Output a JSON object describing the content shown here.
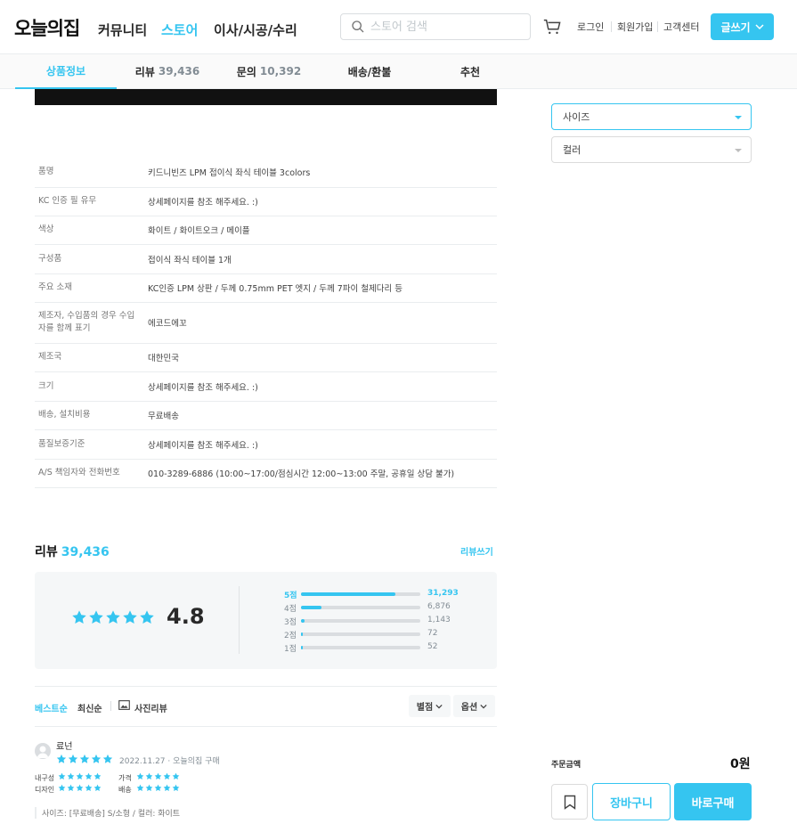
{
  "header": {
    "logo": "오늘의집",
    "nav": [
      "커뮤니티",
      "스토어",
      "이사/시공/수리"
    ],
    "search_placeholder": "스토어 검색",
    "util": [
      "로그인",
      "회원가입",
      "고객센터"
    ],
    "write_label": "글쓰기"
  },
  "tabs": [
    {
      "label": "상품정보",
      "count": ""
    },
    {
      "label": "리뷰",
      "count": "39,436"
    },
    {
      "label": "문의",
      "count": "10,392"
    },
    {
      "label": "배송/환불",
      "count": ""
    },
    {
      "label": "추천",
      "count": ""
    }
  ],
  "spec": [
    {
      "k": "품명",
      "v": "키드니빈즈 LPM 접이식 좌식 테이블 3colors"
    },
    {
      "k": "KC 인증 필 유무",
      "v": "상세페이지를 참조 해주세요. :)"
    },
    {
      "k": "색상",
      "v": "화이트 / 화이트오크 / 메이플"
    },
    {
      "k": "구성품",
      "v": "접이식 좌식 테이블 1개"
    },
    {
      "k": "주요 소재",
      "v": "KC인증 LPM 상판 / 두께 0.75mm PET 엣지 / 두께 7파이 철제다리 등"
    },
    {
      "k": "제조자, 수입품의 경우 수입자를 함께 표기",
      "v": "에코드에꼬"
    },
    {
      "k": "제조국",
      "v": "대한민국"
    },
    {
      "k": "크기",
      "v": "상세페이지를 참조 해주세요. :)"
    },
    {
      "k": "배송, 설치비용",
      "v": "무료배송"
    },
    {
      "k": "품질보증기준",
      "v": "상세페이지를 참조 해주세요. :)"
    },
    {
      "k": "A/S 책임자와 전화번호",
      "v": "010-3289-6886 (10:00~17:00/점심시간 12:00~13:00 주말, 공휴일 상담 불가)"
    }
  ],
  "side": {
    "size_label": "사이즈",
    "color_label": "컬러",
    "order_label": "주문금액",
    "order_value": "0원",
    "cart_label": "장바구니",
    "buy_label": "바로구매"
  },
  "reviews": {
    "title": "리뷰",
    "count": "39,436",
    "write": "리뷰쓰기",
    "score": "4.8",
    "dist": [
      {
        "label": "5점",
        "value": "31,293",
        "ratio": 0.7935
      },
      {
        "label": "4점",
        "value": "6,876",
        "ratio": 0.1744
      },
      {
        "label": "3점",
        "value": "1,143",
        "ratio": 0.029
      },
      {
        "label": "2점",
        "value": "72",
        "ratio": 0.0018
      },
      {
        "label": "1점",
        "value": "52",
        "ratio": 0.0013
      }
    ],
    "sort": [
      "베스트순",
      "최신순",
      "사진리뷰"
    ],
    "filters": [
      "별점",
      "옵션"
    ],
    "item": {
      "user": "료넌",
      "date": "2022.11.27 · 오늘의집 구매",
      "sub": [
        "내구성",
        "가격",
        "디자인",
        "배송"
      ],
      "option": "사이즈: [무료배송] S/소형 / 컬러: 화이트"
    }
  },
  "colors": {
    "accent": "#35c5f0",
    "text": "#292929",
    "muted": "#828c94"
  }
}
